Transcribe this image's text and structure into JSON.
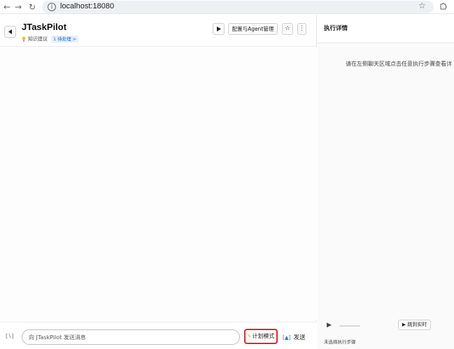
{
  "browser": {
    "url": "localhost:18080",
    "icons": {
      "back": "arrow-left-icon",
      "forward": "arrow-right-icon",
      "reload": "reload-icon",
      "site_info": "info-icon",
      "bookmark": "star-icon",
      "extensions": "puzzle-icon"
    }
  },
  "chat": {
    "title": "JTaskPilot",
    "knowledge_label": "知识建议",
    "pending_badge": "1 待处理 >",
    "config_button": "配置与Agent管理",
    "input_placeholder": "向 JTaskPilot 发送消息",
    "input_value": "",
    "plan_mode_label": "计划模式",
    "send_label": "发送",
    "icons": {
      "back": "back-arrow-icon",
      "bulb": "lightbulb-icon",
      "play": "play-icon",
      "favorite": "star-icon",
      "more": "more-vertical-icon",
      "clear": "clear-context-icon",
      "pencil": "pencil-icon",
      "send": "send-icon"
    }
  },
  "details": {
    "title": "执行详情",
    "hint": "请在左侧聊天区域点击任意执行步骤查看详",
    "jump_label": "跳到实时",
    "no_step_label": "未选择执行步骤",
    "progress": 0
  },
  "colors": {
    "highlight_border": "#e0262c",
    "badge_bg": "#e6f0ff",
    "badge_text": "#1a5fd0"
  }
}
